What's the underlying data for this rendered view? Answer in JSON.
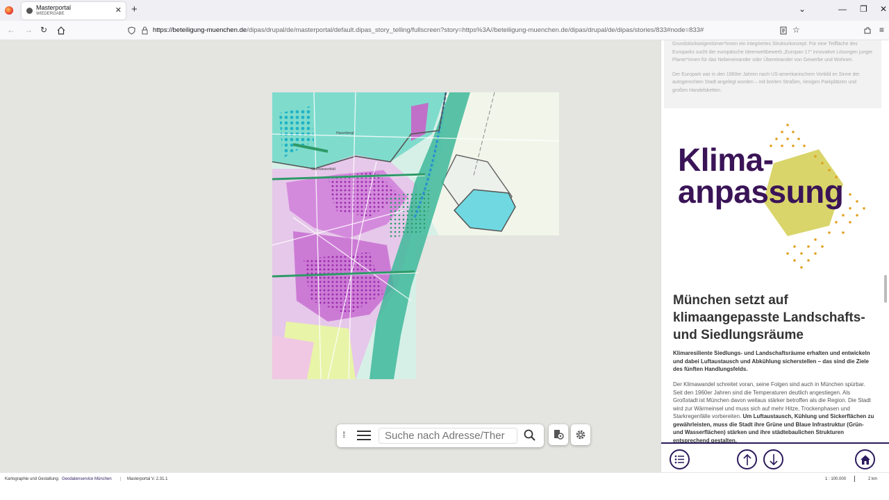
{
  "browser": {
    "tab_title": "Masterportal",
    "tab_subtitle": "WIEDERGABE",
    "url_domain": "https://beteiligung-muenchen.de",
    "url_rest": "/dipas/drupal/de/masterportal/default.dipas_story_telling/fullscreen?story=https%3A//beteiligung-muenchen.de/dipas/drupal/de/dipas/stories/833#node=833#"
  },
  "search": {
    "placeholder": "Suche nach Adresse/Ther"
  },
  "story": {
    "prev_text_1": "Grundstückseigentümer*innen ein integriertes Strukturkonzept. Für eine Teilfläche des Europarks sucht der europäische Ideenwettbewerb „Europan 17“ innovative Lösungen junger Planer*innen für das Nebeneinander oder Übereinander von Gewerbe und Wohnen.",
    "prev_text_2": "Der Europark war in den 1960er Jahren nach US-amerikanischem Vorbild im Sinne der autogerechten Stadt angelegt worden – mit breiten Straßen, riesigen Parkplätzen und großen Handelsketten.",
    "graphic_line1": "Klima-",
    "graphic_line2": "anpassung",
    "heading": "München setzt auf klimaangepasste Landschafts- und Siedlungsräume",
    "lead": "Klimaresiliente Siedlungs- und Landschaftsräume erhalten und entwickeln und dabei Luftaustausch und Abkühlung sicherstellen – das sind die Ziele des fünften Handlungsfelds.",
    "body_normal": "Der Klimawandel schreitet voran, seine Folgen sind auch in München spürbar. Seit den 1960er Jahren sind die Temperaturen deutlich angestiegen. Als Großstadt ist München davon weitaus stärker betroffen als die Region. Die Stadt wird zur Wärmeinsel und muss sich auf mehr Hitze, Trockenphasen und Starkregenfälle vorbereiten. ",
    "body_bold": "Um Luftaustausch, Kühlung und Sickerflächen zu gewährleisten, muss die Stadt ihre Grüne und Blaue Infrastruktur (Grün- und Wasserflächen) stärken und ihre städtebaulichen Strukturen entsprechend gestalten."
  },
  "map_labels": {
    "a": "Hasenbergl",
    "b": "Oberwiesenfeld"
  },
  "status": {
    "credit_label": "Kartographie und Gestaltung:",
    "credit_link": "Geodatenservice München",
    "version": "Masterportal V. 2.31.1",
    "scale": "1 : 100.000",
    "scalebar": "2 km"
  },
  "colors": {
    "accent": "#2b1a5c",
    "klima": "#3a1457",
    "hex": "#d9d56a",
    "dots": "#e0a020"
  }
}
